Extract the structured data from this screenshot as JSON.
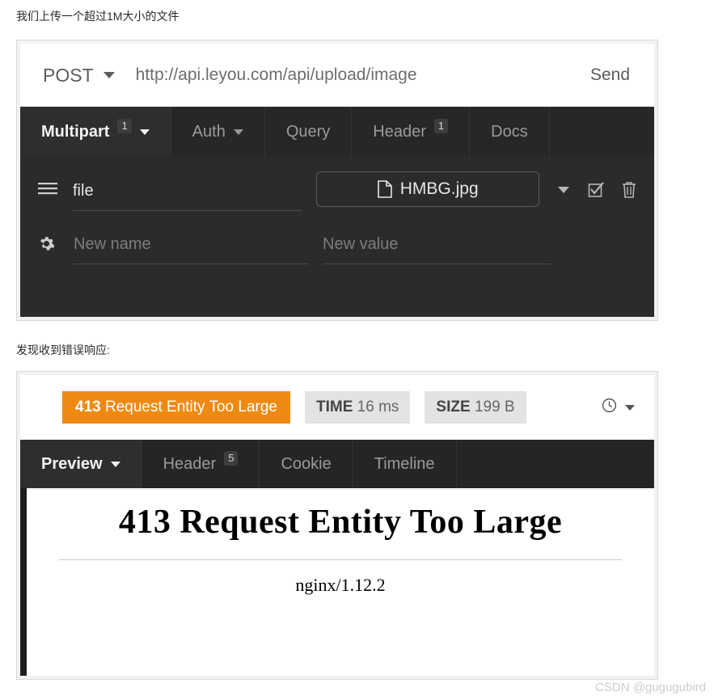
{
  "captions": {
    "first": "我们上传一个超过1M大小的文件",
    "second": "发现收到错误响应:"
  },
  "request_panel": {
    "url_bar": {
      "method": "POST",
      "method_caret_icon": "chevron-down-icon",
      "url": "http://api.leyou.com/api/upload/image",
      "send_label": "Send"
    },
    "tabs": [
      {
        "label": "Multipart",
        "badge": "1",
        "active": true,
        "caret_icon": "chevron-down-icon"
      },
      {
        "label": "Auth",
        "badge": "",
        "active": false,
        "caret_icon": "chevron-down-icon"
      },
      {
        "label": "Query",
        "badge": "",
        "active": false,
        "caret_icon": ""
      },
      {
        "label": "Header",
        "badge": "1",
        "active": false,
        "caret_icon": ""
      },
      {
        "label": "Docs",
        "badge": "",
        "active": false,
        "caret_icon": ""
      }
    ],
    "rows": [
      {
        "handle_icon": "hamburger-drag-handle-icon",
        "name": "file",
        "name_is_placeholder": false,
        "value_type": "file",
        "file_name": "HMBG.jpg",
        "file_icon": "document-file-icon",
        "actions": [
          "chevron-down-icon",
          "checkbox-checked-icon",
          "trash-delete-icon"
        ]
      },
      {
        "handle_icon": "gear-settings-icon",
        "name": "New name",
        "name_is_placeholder": true,
        "value_type": "text",
        "value": "New value",
        "value_is_placeholder": true,
        "actions": []
      }
    ]
  },
  "response_panel": {
    "status": {
      "code": "413",
      "text": "Request Entity Too Large",
      "color": "#ee8a12",
      "time_label": "TIME",
      "time_value": "16 ms",
      "size_label": "SIZE",
      "size_value": "199 B",
      "history_icon": "clock-history-icon",
      "history_caret_icon": "chevron-down-icon"
    },
    "tabs": [
      {
        "label": "Preview",
        "badge": "",
        "active": true,
        "caret_icon": "chevron-down-icon"
      },
      {
        "label": "Header",
        "badge": "5",
        "active": false,
        "caret_icon": ""
      },
      {
        "label": "Cookie",
        "badge": "",
        "active": false,
        "caret_icon": ""
      },
      {
        "label": "Timeline",
        "badge": "",
        "active": false,
        "caret_icon": ""
      }
    ],
    "preview": {
      "title": "413 Request Entity Too Large",
      "server": "nginx/1.12.2"
    }
  },
  "watermark": "CSDN @gugugubird"
}
